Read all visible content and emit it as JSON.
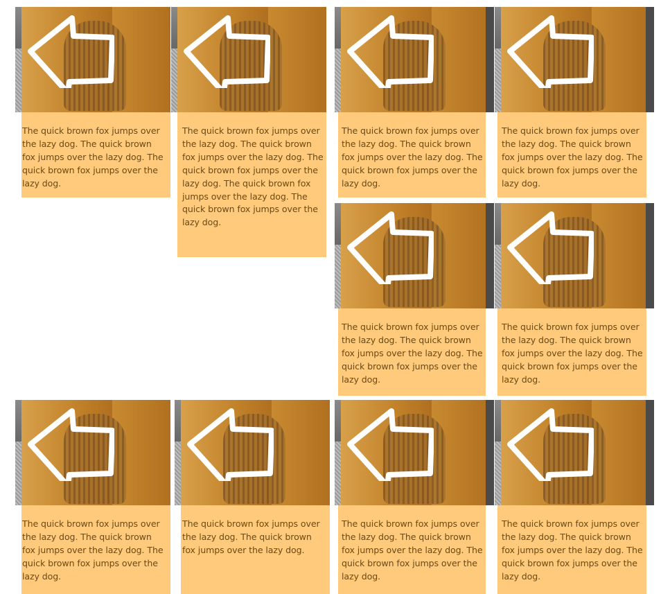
{
  "cards": [
    {
      "text": "The quick brown fox jumps over the lazy dog. The quick brown fox jumps over the lazy dog. The quick brown fox jumps over the lazy dog."
    },
    {
      "text": "The quick brown fox jumps over the lazy dog. The quick brown fox jumps over the lazy dog. The quick brown fox jumps over the lazy dog. The quick brown fox jumps over the lazy dog. The quick brown fox jumps over the lazy dog."
    },
    {
      "text": "The quick brown fox jumps over the lazy dog. The quick brown fox jumps over the lazy dog. The quick brown fox jumps over the lazy dog."
    },
    {
      "text": "The quick brown fox jumps over the lazy dog. The quick brown fox jumps over the lazy dog. The quick brown fox jumps over the lazy dog."
    },
    {
      "text": "The quick brown fox jumps over the lazy dog. The quick brown fox jumps over the lazy dog. The quick brown fox jumps over the lazy dog."
    },
    {
      "text": "The quick brown fox jumps over the lazy dog. The quick brown fox jumps over the lazy dog. The quick brown fox jumps over the lazy dog."
    },
    {
      "text": "The quick brown fox jumps over the lazy dog. The quick brown fox jumps over the lazy dog. The quick brown fox jumps over the lazy dog."
    },
    {
      "text": "The quick brown fox jumps over the lazy dog. The quick brown fox jumps over the lazy dog."
    },
    {
      "text": "The quick brown fox jumps over the lazy dog. The quick brown fox jumps over the lazy dog. The quick brown fox jumps over the lazy dog."
    },
    {
      "text": "The quick brown fox jumps over the lazy dog. The quick brown fox jumps over the lazy dog. The quick brown fox jumps over the lazy dog."
    }
  ],
  "icons": {
    "arrow": "left-arrow-icon",
    "photo": "kitten-photo"
  }
}
